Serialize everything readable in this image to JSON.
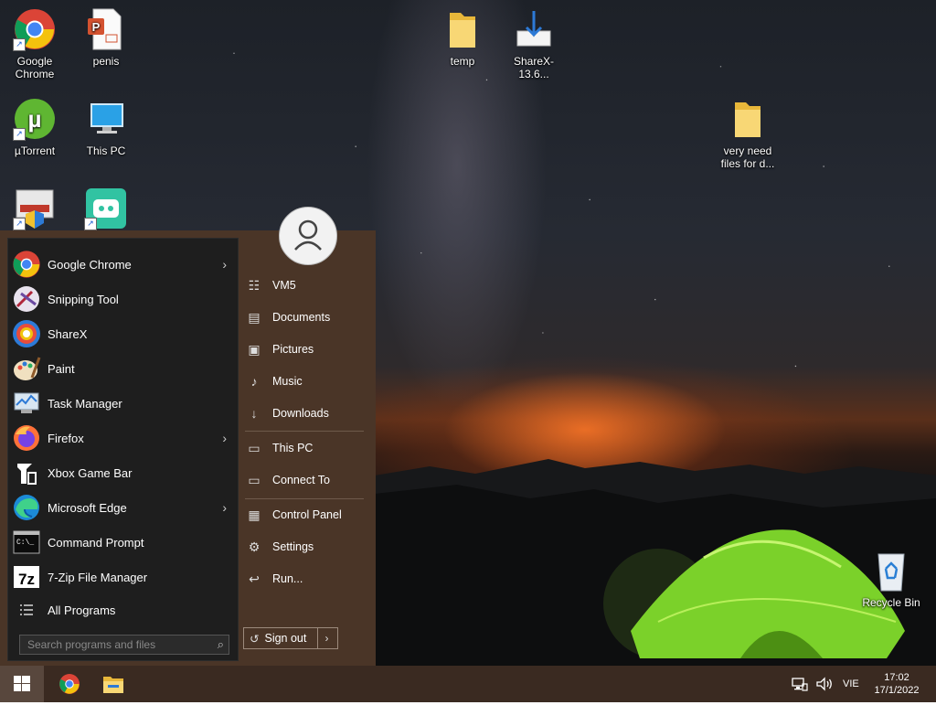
{
  "desktop": {
    "icons": [
      {
        "label": "Google\nChrome",
        "icon": "chrome-icon"
      },
      {
        "label": "penis",
        "icon": "pptx-file-icon"
      },
      {
        "label": "µTorrent",
        "icon": "utorrent-icon"
      },
      {
        "label": "This PC",
        "icon": "this-pc-icon"
      },
      {
        "label": "",
        "icon": "disk-cleanup-icon"
      },
      {
        "label": "",
        "icon": "streamlabs-icon"
      },
      {
        "label": "temp",
        "icon": "folder-icon"
      },
      {
        "label": "ShareX-13.6...",
        "icon": "installer-icon"
      },
      {
        "label": "very need\nfiles for d...",
        "icon": "folder-icon"
      },
      {
        "label": "Recycle Bin",
        "icon": "recycle-bin-icon"
      }
    ]
  },
  "start_menu": {
    "programs": [
      {
        "label": "Google Chrome",
        "icon": "chrome-icon",
        "has_submenu": true
      },
      {
        "label": "Snipping Tool",
        "icon": "snipping-tool-icon",
        "has_submenu": false
      },
      {
        "label": "ShareX",
        "icon": "sharex-icon",
        "has_submenu": false
      },
      {
        "label": "Paint",
        "icon": "paint-icon",
        "has_submenu": false
      },
      {
        "label": "Task Manager",
        "icon": "task-manager-icon",
        "has_submenu": false
      },
      {
        "label": "Firefox",
        "icon": "firefox-icon",
        "has_submenu": true
      },
      {
        "label": "Xbox Game Bar",
        "icon": "xbox-game-bar-icon",
        "has_submenu": false
      },
      {
        "label": "Microsoft Edge",
        "icon": "edge-icon",
        "has_submenu": true
      },
      {
        "label": "Command Prompt",
        "icon": "command-prompt-icon",
        "has_submenu": false
      },
      {
        "label": "7-Zip File Manager",
        "icon": "7zip-icon",
        "has_submenu": false
      }
    ],
    "all_programs": "All Programs",
    "search_placeholder": "Search programs and files",
    "right_links": [
      {
        "label": "VM5",
        "icon": "user-folder-icon"
      },
      {
        "label": "Documents",
        "icon": "documents-icon"
      },
      {
        "label": "Pictures",
        "icon": "pictures-icon"
      },
      {
        "label": "Music",
        "icon": "music-icon"
      },
      {
        "label": "Downloads",
        "icon": "downloads-icon"
      },
      {
        "label": "This PC",
        "icon": "this-pc-icon"
      },
      {
        "label": "Connect To",
        "icon": "connect-to-icon"
      },
      {
        "label": "Control Panel",
        "icon": "control-panel-icon"
      },
      {
        "label": "Settings",
        "icon": "settings-gear-icon"
      },
      {
        "label": "Run...",
        "icon": "run-icon"
      }
    ],
    "sign_out": "Sign out"
  },
  "taskbar": {
    "pinned": [
      "chrome-icon",
      "file-explorer-icon"
    ],
    "language": "VIE",
    "time": "17:02",
    "date": "17/1/2022"
  },
  "colors": {
    "start_bg": "#4a3527",
    "programs_bg": "#1e1e1e",
    "taskbar_bg": "#3a2a21"
  }
}
